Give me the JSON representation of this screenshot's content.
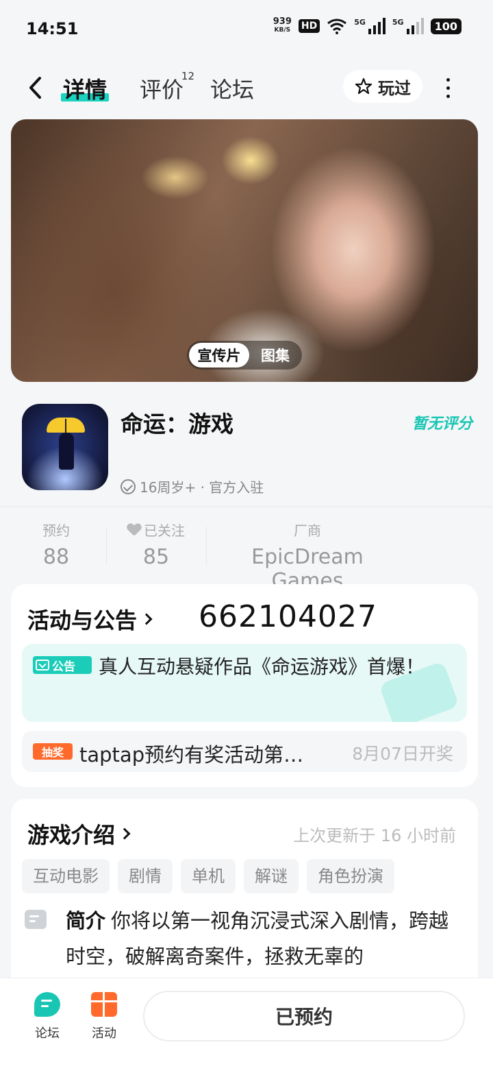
{
  "status_bar": {
    "time": "14:51",
    "net_speed": "939",
    "net_unit": "KB/S",
    "hd": "HD",
    "battery": "100",
    "signal_1": "5G",
    "signal_2": "5G"
  },
  "nav": {
    "tabs": [
      {
        "label": "详情",
        "active": true
      },
      {
        "label": "评价",
        "badge": "12"
      },
      {
        "label": "论坛"
      }
    ],
    "played_label": "玩过"
  },
  "hero": {
    "toggle_video": "宣传片",
    "toggle_gallery": "图集"
  },
  "game": {
    "name": "命运：游戏",
    "score_label": "暂无评分",
    "meta": "16周岁+ · 官方入驻"
  },
  "stats": [
    {
      "label": "预约",
      "value": "88"
    },
    {
      "label": "已关注",
      "value": "85"
    },
    {
      "label": "厂商",
      "value": "EpicDream Games"
    }
  ],
  "activity": {
    "title": "活动与公告",
    "handwritten_number": "662104027",
    "notice_tag": "公告",
    "notice_text": "真人互动悬疑作品《命运游戏》首爆！",
    "lottery_tag": "抽奖",
    "lottery_text": "taptap预约有奖活动第…",
    "lottery_date": "8月07日开奖"
  },
  "intro": {
    "title": "游戏介绍",
    "updated": "上次更新于 16 小时前",
    "tags": [
      "互动电影",
      "剧情",
      "单机",
      "解谜",
      "角色扮演"
    ],
    "summary_label": "简介",
    "summary_text": "你将以第一视角沉浸式深入剧情，跨越时空，破解离奇案件，拯救无辜的"
  },
  "bottom_bar": {
    "forum_label": "论坛",
    "activity_label": "活动",
    "reserve_button": "已预约"
  },
  "colors": {
    "accent": "#19c6b3",
    "orange": "#ff6a2c",
    "background": "#f5f6f8"
  }
}
